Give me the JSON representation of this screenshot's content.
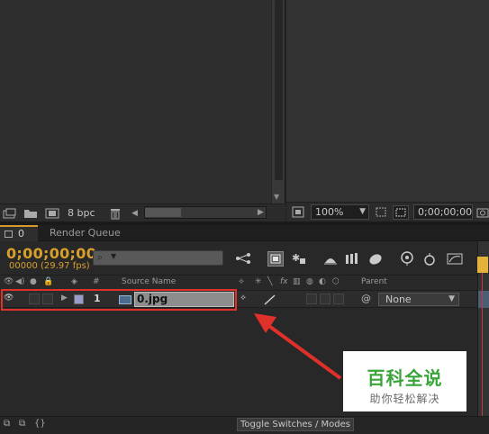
{
  "project_panel": {
    "bit_depth": "8 bpc"
  },
  "viewer_bar": {
    "zoom": "100%",
    "timecode": "0;00;00;00"
  },
  "timeline": {
    "tabs": [
      {
        "label": "0"
      },
      {
        "label": "Render Queue"
      }
    ],
    "current_time": "0;00;00;00",
    "frame_info": "00000 (29.97 fps)",
    "columns": {
      "number": "#",
      "source_name": "Source Name",
      "parent": "Parent"
    },
    "layers": [
      {
        "number": "1",
        "name": "0.jpg",
        "parent": "None"
      }
    ]
  },
  "bottom_bar": {
    "toggle_label": "Toggle Switches / Modes"
  },
  "watermark": {
    "title": "百科全说",
    "subtitle": "助你轻松解决"
  },
  "colors": {
    "accent": "#d8a02b",
    "annotation": "#e0302a",
    "watermark_green": "#3aa33a"
  },
  "icons": [
    "eye-icon",
    "speaker-icon",
    "solo-icon",
    "lock-icon",
    "tag-icon",
    "search-icon",
    "trash-icon",
    "folder-icon",
    "composition-icon",
    "graph-editor-icon"
  ]
}
